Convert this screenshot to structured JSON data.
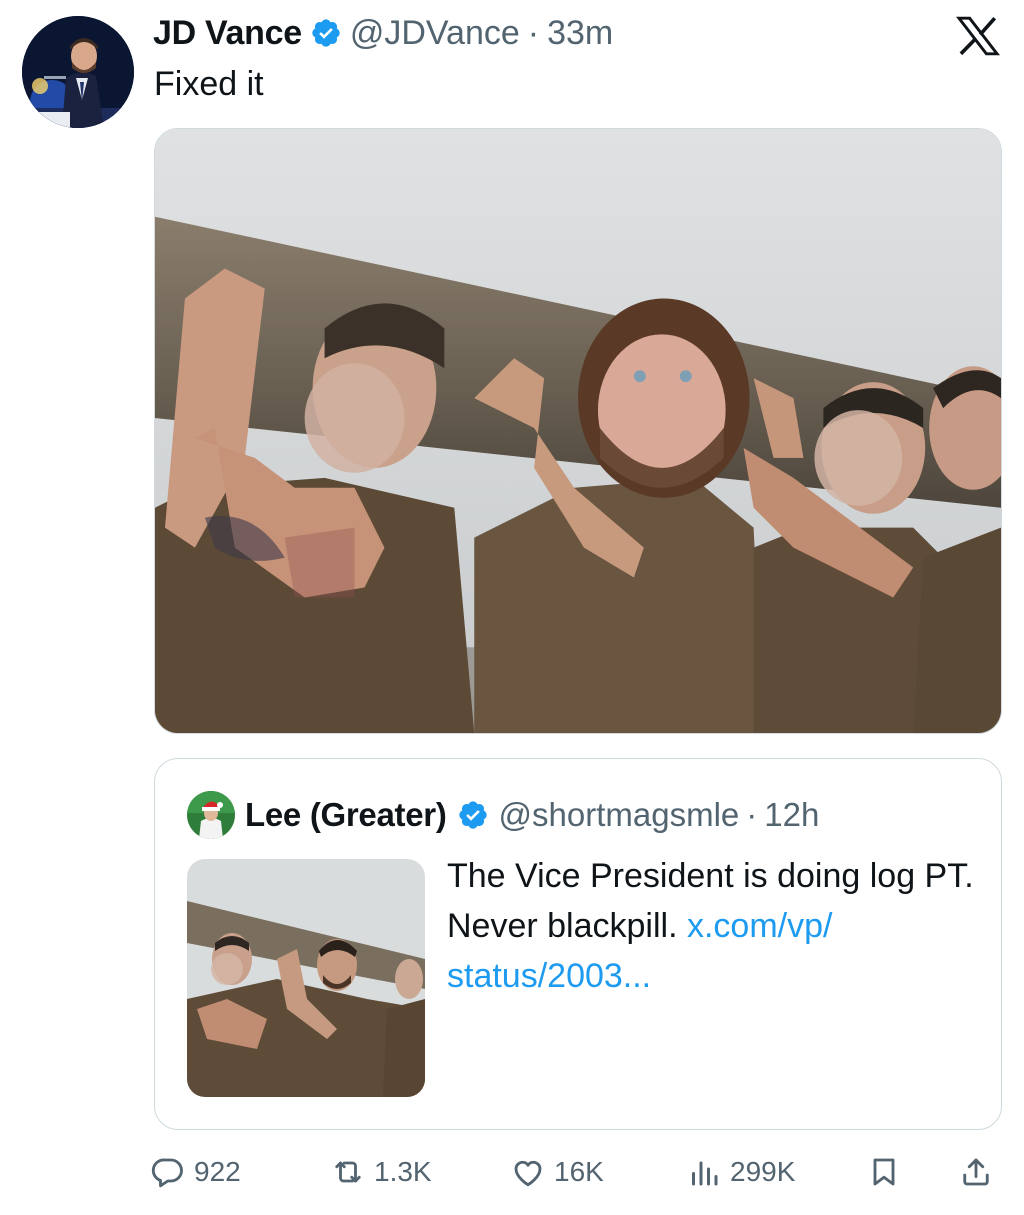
{
  "post": {
    "author_name": "JD Vance",
    "handle": "@JDVance",
    "separator": "·",
    "time": "33m",
    "text": "Fixed it"
  },
  "quoted": {
    "author_name": "Lee (Greater)",
    "handle": "@shortmagsmle",
    "separator": "·",
    "time": "12h",
    "text": "The Vice President is doing log PT. Never blackpill.",
    "link_text": "x.com/vp/​status/2003..."
  },
  "actions": {
    "replies": "922",
    "reposts": "1.3K",
    "likes": "16K",
    "views": "299K"
  },
  "icons": {
    "brand": "x-logo-icon",
    "verified": "verified-badge-icon",
    "reply": "reply-icon",
    "repost": "repost-icon",
    "like": "heart-icon",
    "views": "views-icon",
    "bookmark": "bookmark-icon",
    "share": "share-icon"
  },
  "colors": {
    "text": "#0f1419",
    "secondary": "#536471",
    "link": "#1d9bf0",
    "verified": "#1d9bf0",
    "border": "#cfd9de"
  }
}
